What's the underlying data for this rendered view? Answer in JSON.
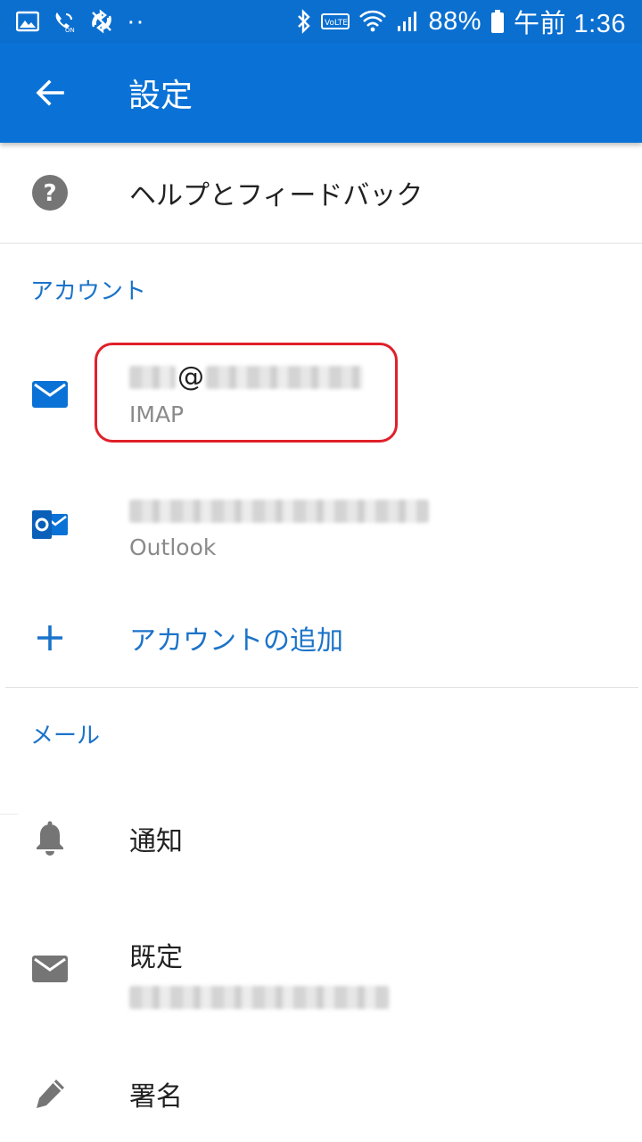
{
  "status_bar": {
    "battery": "88%",
    "time": "午前 1:36",
    "volte": "VoLTE",
    "dots": "··"
  },
  "app_bar": {
    "title": "設定"
  },
  "help": {
    "label": "ヘルプとフィードバック"
  },
  "accounts_section": {
    "header": "アカウント",
    "items": [
      {
        "email_at": "@",
        "type": "IMAP"
      },
      {
        "type": "Outlook"
      }
    ],
    "add_label": "アカウントの追加"
  },
  "mail_section": {
    "header": "メール",
    "notifications": "通知",
    "default_label": "既定",
    "signature": "署名"
  },
  "colors": {
    "primary": "#0a72d6",
    "accent_text": "#1a73c9",
    "highlight": "#e0202a"
  },
  "icons": {
    "back": "arrow-left-icon",
    "help": "question-circle-icon",
    "mail": "mail-icon",
    "outlook": "outlook-icon",
    "add": "plus-icon",
    "bell": "bell-icon",
    "signature": "pen-icon"
  }
}
